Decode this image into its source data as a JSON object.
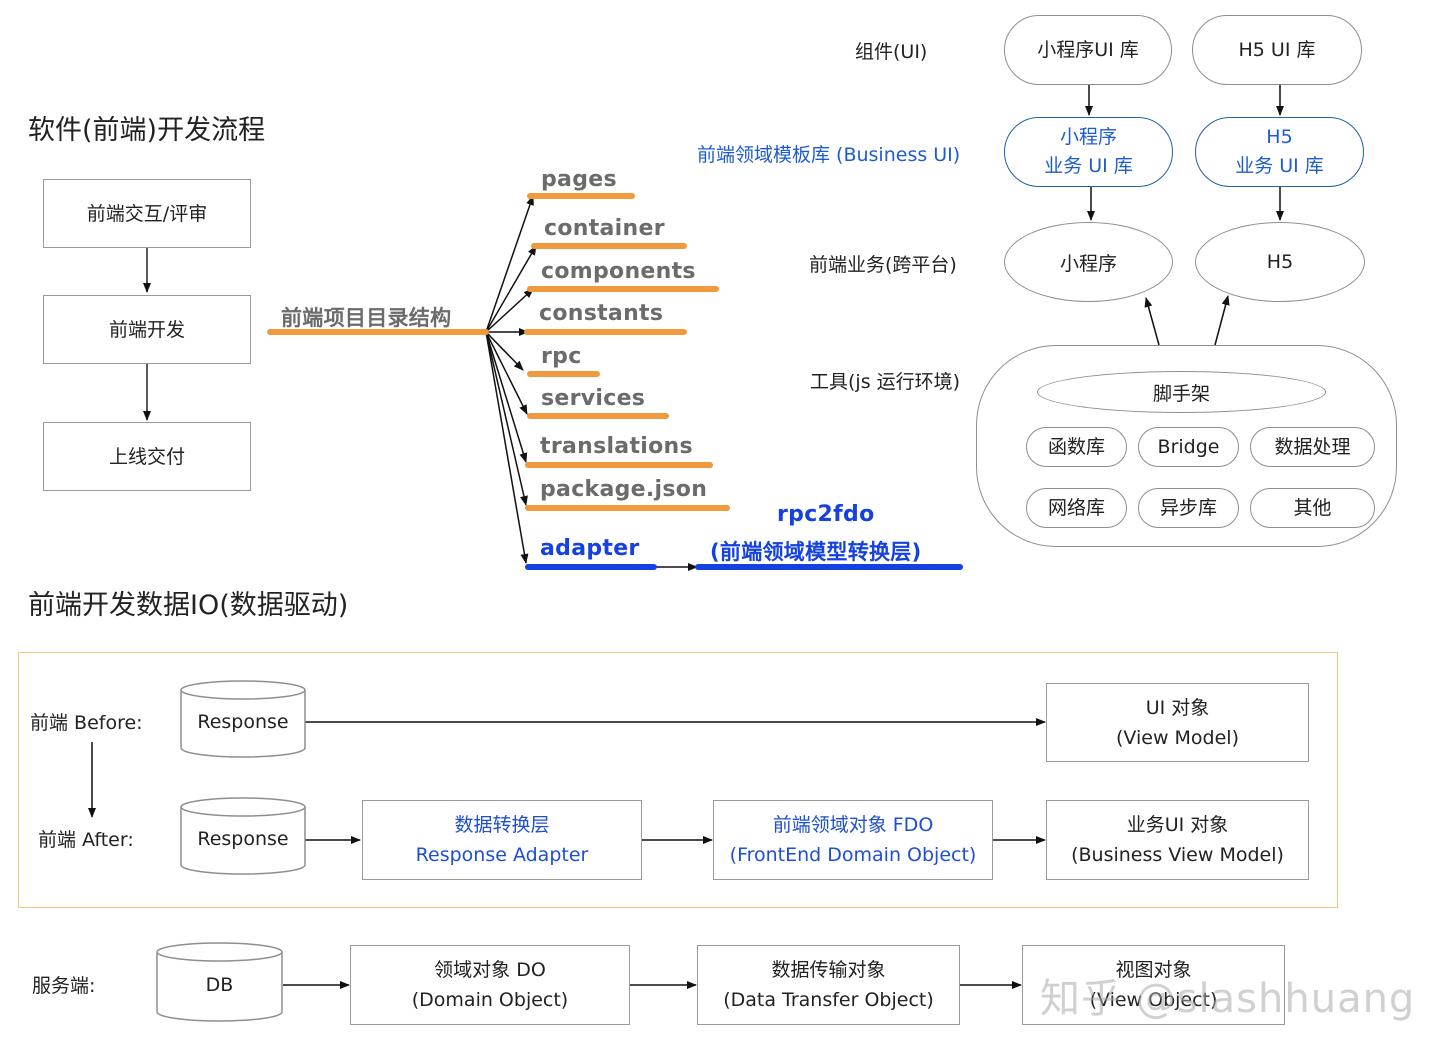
{
  "flow": {
    "title": "软件(前端)开发流程",
    "steps": [
      "前端交互/评审",
      "前端开发",
      "上线交付"
    ]
  },
  "directory": {
    "root_label": "前端项目目录结构",
    "items": [
      "pages",
      "container",
      "components",
      "constants",
      "rpc",
      "services",
      "translations",
      "package.json"
    ],
    "adapter": "adapter",
    "rpc2fdo_title": "rpc2fdo",
    "rpc2fdo_subtitle": "(前端领域模型转换层)"
  },
  "architecture": {
    "row_labels": {
      "components": "组件(UI)",
      "business_ui": "前端领域模板库 (Business UI)",
      "business": "前端业务(跨平台)",
      "tools": "工具(js 运行环境)"
    },
    "ui_libs": [
      "小程序UI 库",
      "H5 UI 库"
    ],
    "business_libs": [
      {
        "line1": "小程序",
        "line2": "业务 UI 库"
      },
      {
        "line1": "H5",
        "line2": "业务 UI 库"
      }
    ],
    "platforms": [
      "小程序",
      "H5"
    ],
    "scaffold": "脚手架",
    "tools": [
      "函数库",
      "Bridge",
      "数据处理",
      "网络库",
      "异步库",
      "其他"
    ]
  },
  "data_io": {
    "title": "前端开发数据IO(数据驱动)",
    "before_label": "前端 Before:",
    "after_label": "前端 After:",
    "response": "Response",
    "before_target": {
      "line1": "UI 对象",
      "line2": "(View Model)"
    },
    "adapter_box": {
      "line1": "数据转换层",
      "line2": "Response Adapter"
    },
    "fdo_box": {
      "line1": "前端领域对象 FDO",
      "line2": "(FrontEnd Domain Object)"
    },
    "after_target": {
      "line1": "业务UI 对象",
      "line2": "(Business View Model)"
    }
  },
  "server": {
    "label": "服务端:",
    "db": "DB",
    "do_box": {
      "line1": "领域对象 DO",
      "line2": "(Domain Object)"
    },
    "dto_box": {
      "line1": "数据传输对象",
      "line2": "(Data Transfer Object)"
    },
    "vo_box": {
      "line1": "视图对象",
      "line2": "(View Object)"
    }
  },
  "watermark": "知乎 @slashhuang",
  "colors": {
    "orange_bar": "#ef9a3c",
    "blue_accent": "#1441e0",
    "frame_border": "#f0c77d"
  }
}
